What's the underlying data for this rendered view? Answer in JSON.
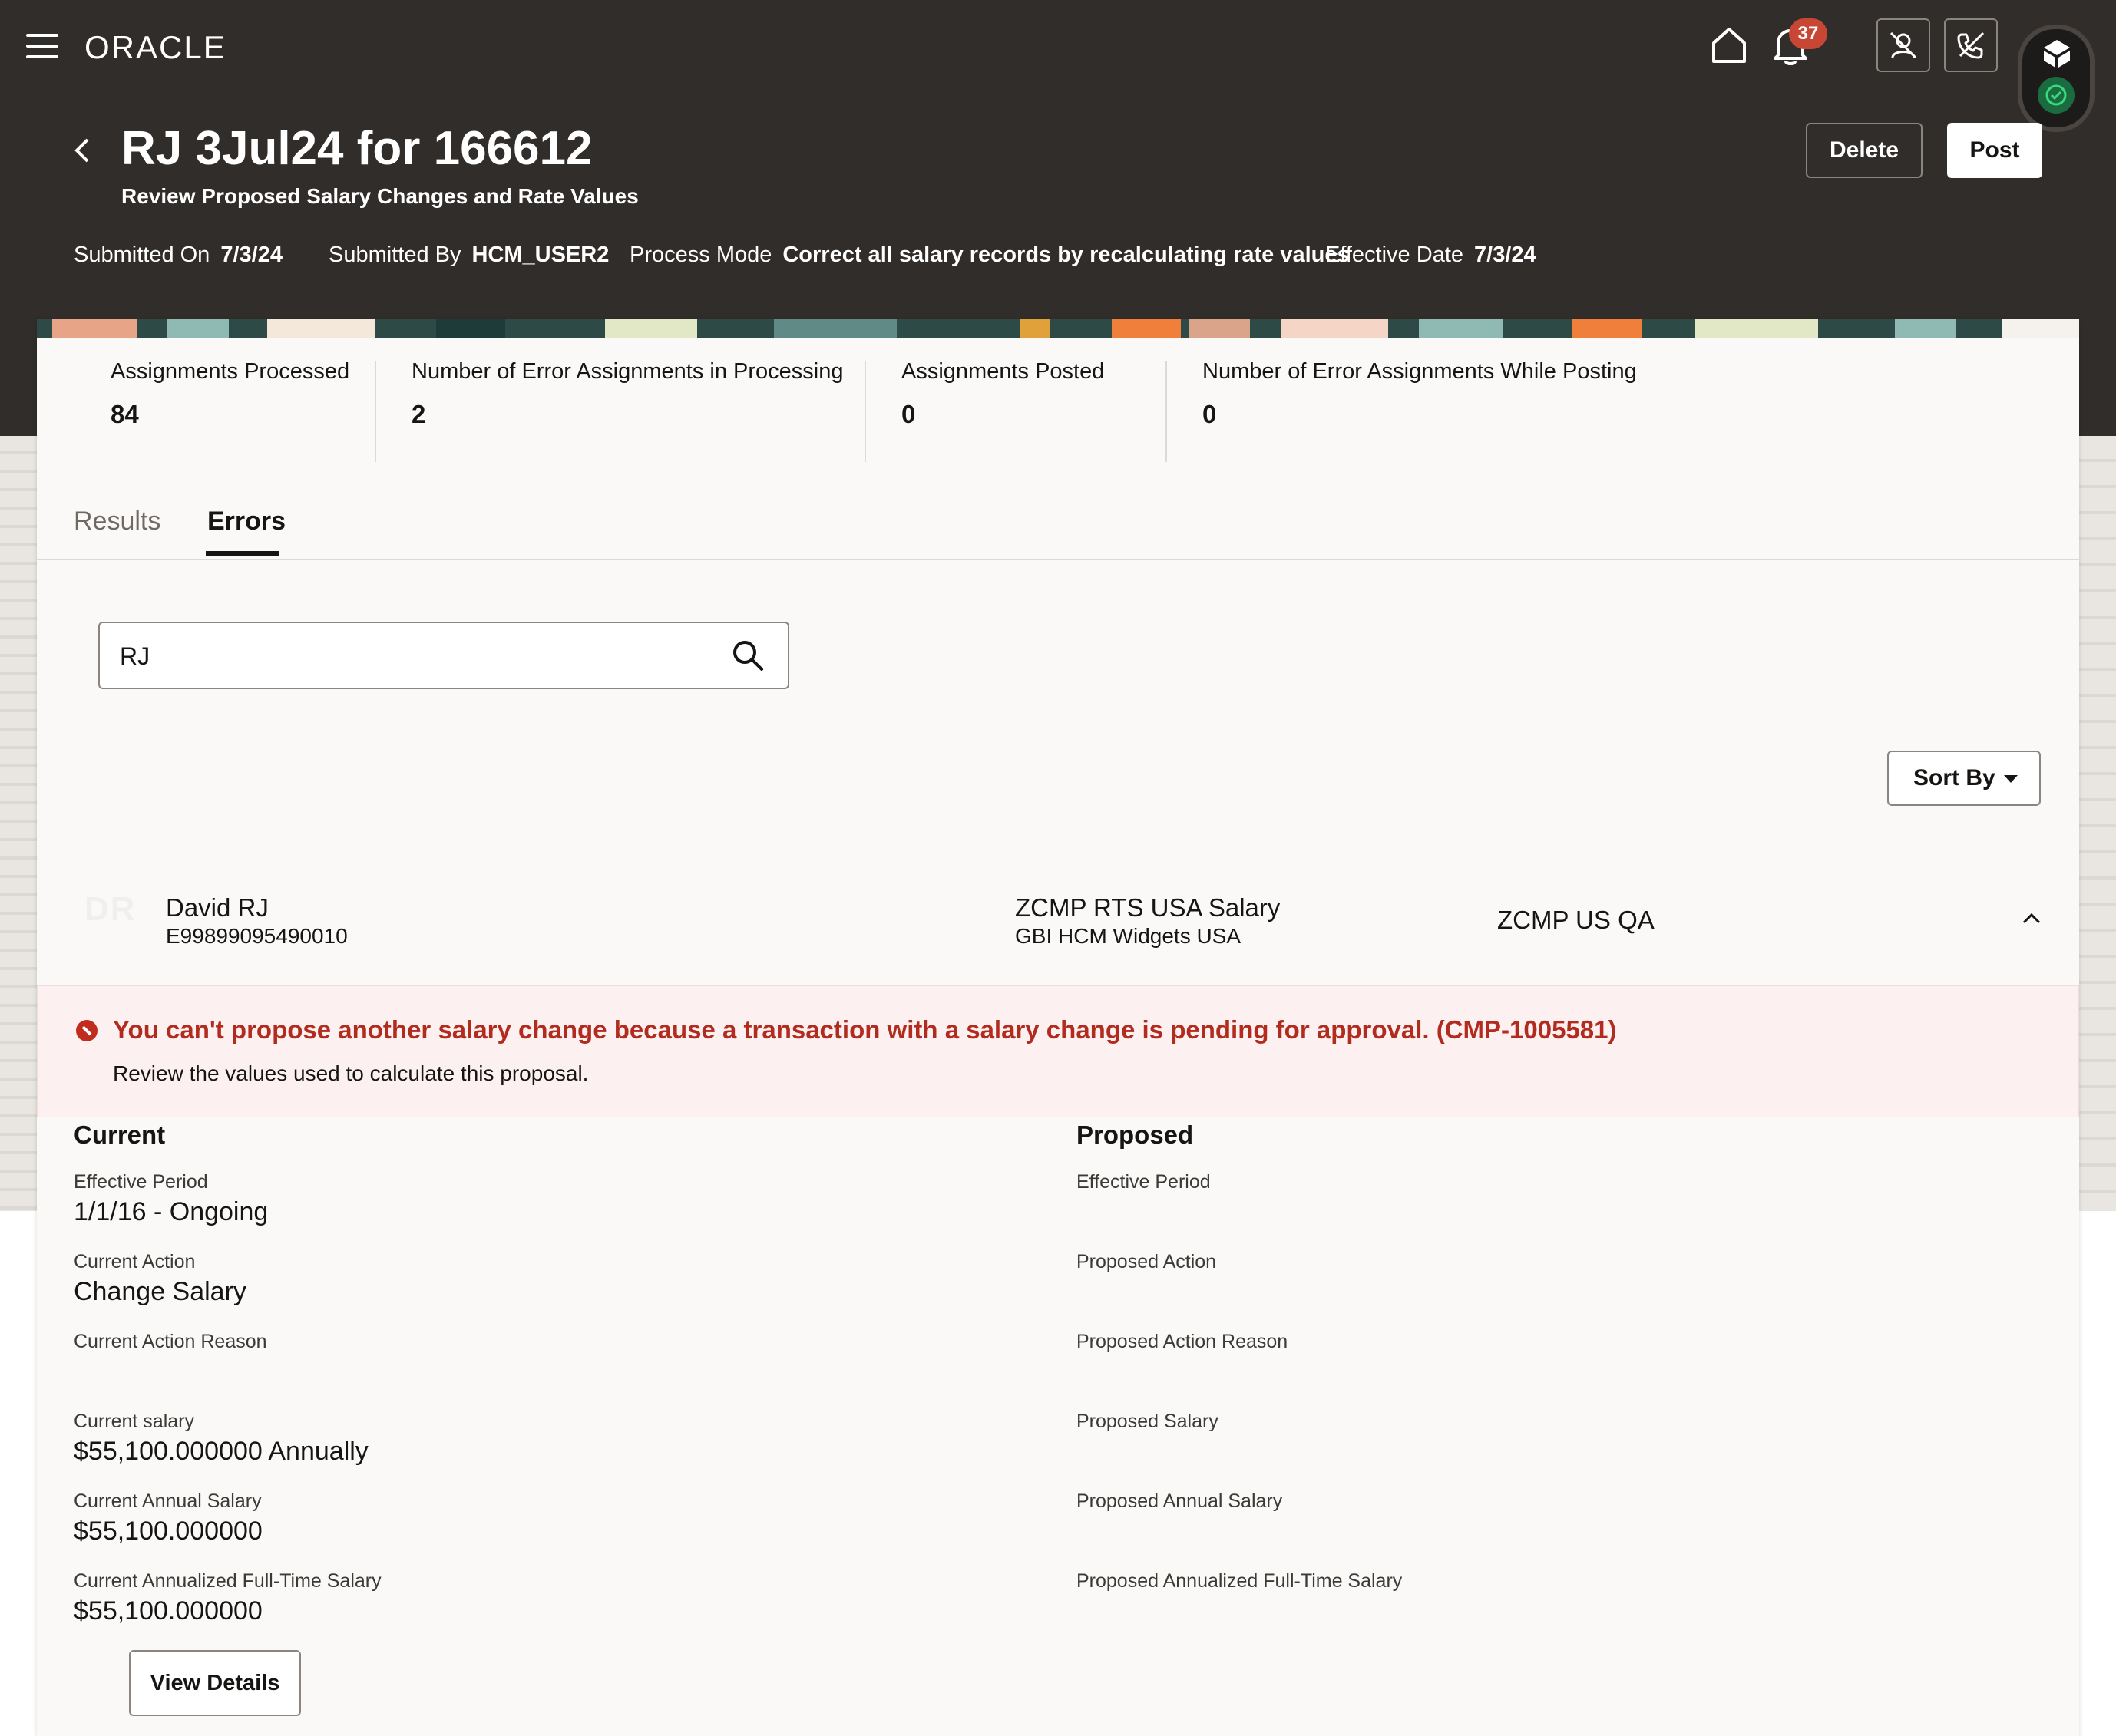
{
  "header": {
    "brand": "ORACLE",
    "notification_count": "37"
  },
  "page": {
    "title": "RJ 3Jul24 for 166612",
    "subtitle": "Review Proposed Salary Changes and Rate Values",
    "delete_label": "Delete",
    "post_label": "Post",
    "meta": [
      {
        "label": "Submitted On",
        "value": "7/3/24"
      },
      {
        "label": "Submitted By",
        "value": "HCM_USER2"
      },
      {
        "label": "Process Mode",
        "value": "Correct all salary records by recalculating rate values"
      },
      {
        "label": "Effective Date",
        "value": "7/3/24"
      }
    ]
  },
  "stats": [
    {
      "label": "Assignments Processed",
      "value": "84"
    },
    {
      "label": "Number of Error Assignments in Processing",
      "value": "2"
    },
    {
      "label": "Assignments Posted",
      "value": "0"
    },
    {
      "label": "Number of Error Assignments While Posting",
      "value": "0"
    }
  ],
  "tabs": [
    {
      "label": "Results",
      "active": false
    },
    {
      "label": "Errors",
      "active": true
    }
  ],
  "search": {
    "value": "RJ"
  },
  "sort_label": "Sort By",
  "record": {
    "initials": "DR",
    "name": "David RJ",
    "person_id": "E99899095490010",
    "plan": "ZCMP RTS USA Salary",
    "plan_org": "GBI HCM Widgets USA",
    "team": "ZCMP US QA"
  },
  "error": {
    "message": "You can't propose another salary change because a transaction with a salary change is pending for approval. (CMP-1005581)",
    "detail": "Review the values used to calculate this proposal."
  },
  "current": {
    "heading": "Current",
    "fields": [
      {
        "label": "Effective Period",
        "value": "1/1/16 - Ongoing"
      },
      {
        "label": "Current Action",
        "value": "Change Salary"
      },
      {
        "label": "Current Action Reason",
        "value": ""
      },
      {
        "label": "Current salary",
        "value": "$55,100.000000 Annually"
      },
      {
        "label": "Current Annual Salary",
        "value": "$55,100.000000"
      },
      {
        "label": "Current Annualized Full-Time Salary",
        "value": "$55,100.000000"
      }
    ]
  },
  "proposed": {
    "heading": "Proposed",
    "fields": [
      {
        "label": "Effective Period",
        "value": ""
      },
      {
        "label": "Proposed Action",
        "value": ""
      },
      {
        "label": "Proposed Action Reason",
        "value": ""
      },
      {
        "label": "Proposed Salary",
        "value": ""
      },
      {
        "label": "Proposed Annual Salary",
        "value": ""
      },
      {
        "label": "Proposed Annualized Full-Time Salary",
        "value": ""
      }
    ]
  },
  "view_details_label": "View Details",
  "colors": {
    "header_bg": "#312d2a",
    "error_text": "#b22b1f",
    "badge": "#c74634",
    "status_ok": "#1a6b3f"
  },
  "icons": [
    "hamburger-icon",
    "home-icon",
    "bell-icon",
    "search-icon",
    "chevron-up-icon",
    "back-chevron-icon",
    "error-icon"
  ]
}
